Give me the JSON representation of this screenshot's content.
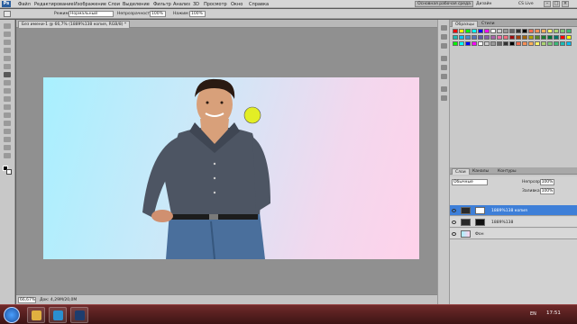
{
  "app": {
    "logo": "Ps",
    "menu": [
      "Файл",
      "Редактирование",
      "Изображение",
      "Слои",
      "Выделение",
      "Фильтр",
      "Анализ",
      "3D",
      "Просмотр",
      "Окно",
      "Справка"
    ],
    "workspace_button": "Основная рабочая среда",
    "design_label": "Дизайн",
    "cs_live": "CS Live",
    "win_controls": [
      "–",
      "□",
      "×"
    ]
  },
  "options_bar": {
    "mode_label": "Режим:",
    "mode_value": "Нормальный",
    "opacity_label": "Непрозрачность:",
    "opacity_value": "100%",
    "pressure_label": "Нажим:",
    "pressure_value": "100%"
  },
  "document": {
    "tab_title": "Без имени-1 @ 66,7% (1889%138 копия, RGB/8) *",
    "zoom": "66,67%",
    "info": "Док: 4,29M/20,0M"
  },
  "panels": {
    "top_tabs": [
      "Образцы",
      "Стили"
    ],
    "layers_tabs": [
      "Слои",
      "Каналы",
      "Контуры"
    ],
    "blend_mode": "Обычные",
    "opacity_label": "Непрозр.:",
    "opacity_value": "100%",
    "fill_label": "Заливка:",
    "fill_value": "100%",
    "layers": [
      {
        "name": "1889%138 копия",
        "selected": true
      },
      {
        "name": "1889%138",
        "selected": false
      },
      {
        "name": "Фон",
        "selected": false
      }
    ]
  },
  "taskbar": {
    "lang": "EN",
    "time": "17:51"
  },
  "colors": {
    "accent": "#3e7fd8",
    "taskbar": "#5a1e1e",
    "canvas_left": "#a8f0ff",
    "canvas_right": "#ffd2ea"
  }
}
